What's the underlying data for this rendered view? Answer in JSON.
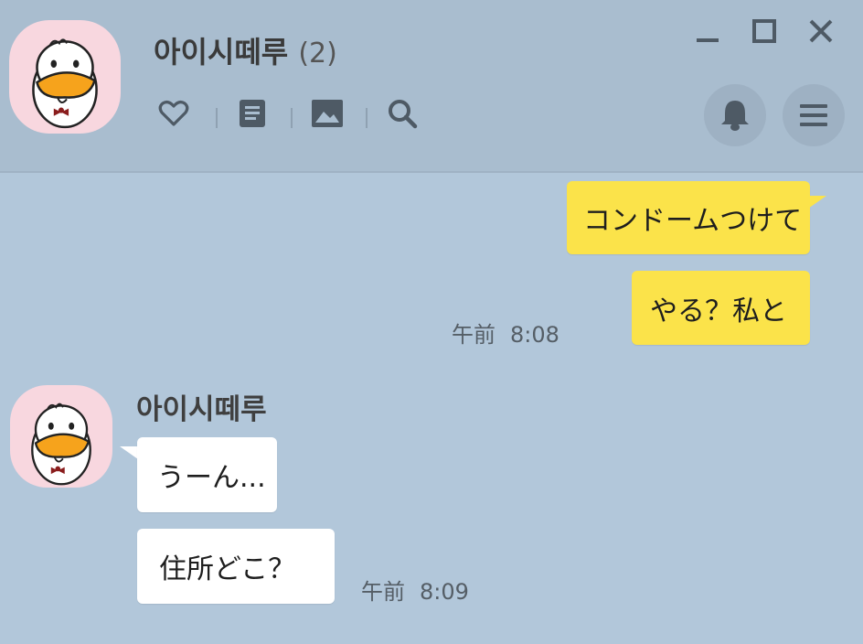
{
  "colors": {
    "background": "#b2c7da",
    "header": "#a9bdcf",
    "outgoing_bubble": "#fbe34a",
    "incoming_bubble": "#ffffff",
    "avatar_bg": "#f8d7df"
  },
  "header": {
    "chat_name": "아이시떼루",
    "member_count": "(2)",
    "toolbar": [
      "heart-icon",
      "notes-icon",
      "album-icon",
      "search-icon"
    ],
    "window_controls": [
      "minimize-icon",
      "maximize-icon",
      "close-icon"
    ],
    "actions": [
      "bell-icon",
      "menu-icon"
    ]
  },
  "messages": {
    "outgoing": {
      "bubble1": "コンドームつけて",
      "bubble2": "やる？私と",
      "time_period": "午前",
      "time": "8:08"
    },
    "incoming": {
      "sender": "아이시떼루",
      "bubble1": "うーん...",
      "bubble2": "住所どこ？",
      "time_period": "午前",
      "time": "8:09"
    }
  }
}
